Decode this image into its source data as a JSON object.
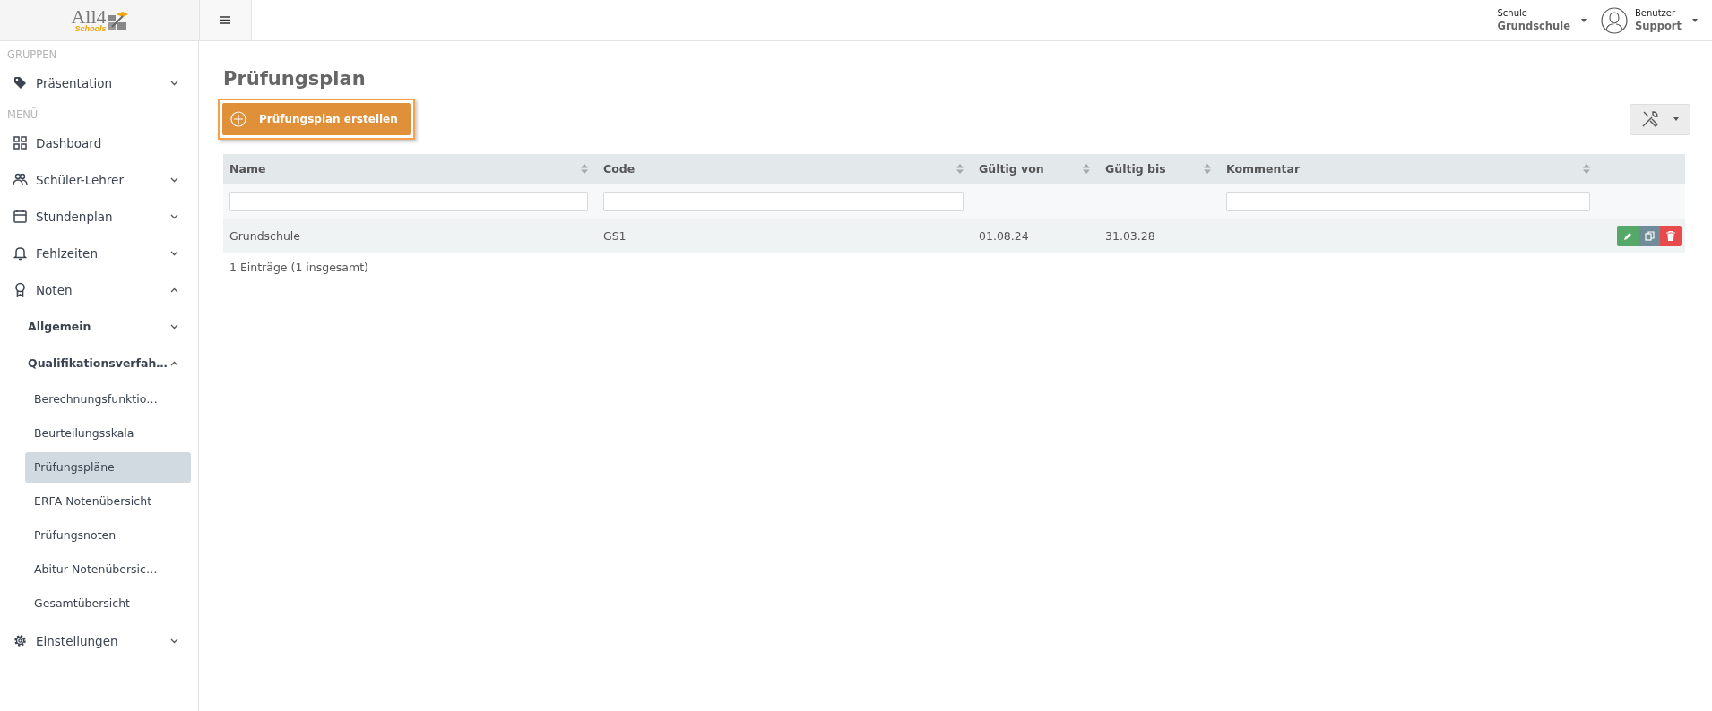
{
  "header": {
    "logo": {
      "name": "All4",
      "tagline": "Schools"
    },
    "school": {
      "label": "Schule",
      "value": "Grundschule"
    },
    "user": {
      "label": "Benutzer",
      "value": "Support"
    }
  },
  "sidebar": {
    "sections": [
      {
        "title": "GRUPPEN",
        "items": [
          {
            "label": "Präsentation",
            "expanded": false
          }
        ]
      },
      {
        "title": "MENÜ",
        "items": [
          {
            "label": "Dashboard"
          },
          {
            "label": "Schüler-Lehrer",
            "expanded": false
          },
          {
            "label": "Stundenplan",
            "expanded": false
          },
          {
            "label": "Fehlzeiten",
            "expanded": false
          },
          {
            "label": "Noten",
            "expanded": true,
            "children": [
              {
                "label": "Allgemein",
                "expanded": false
              },
              {
                "label": "Qualifikationsverfah…",
                "expanded": true,
                "children": [
                  {
                    "label": "Berechnungsfunktio…",
                    "selected": false
                  },
                  {
                    "label": "Beurteilungsskala",
                    "selected": false
                  },
                  {
                    "label": "Prüfungspläne",
                    "selected": true
                  },
                  {
                    "label": "ERFA Notenübersicht",
                    "selected": false
                  },
                  {
                    "label": "Prüfungsnoten",
                    "selected": false
                  },
                  {
                    "label": "Abitur Notenübersic…",
                    "selected": false
                  },
                  {
                    "label": "Gesamtübersicht",
                    "selected": false
                  }
                ]
              }
            ]
          },
          {
            "label": "Einstellungen",
            "expanded": false
          }
        ]
      }
    ]
  },
  "page": {
    "title": "Prüfungsplan",
    "create_button": "Prüfungsplan erstellen",
    "table": {
      "columns": [
        {
          "label": "Name",
          "filter": true
        },
        {
          "label": "Code",
          "filter": true
        },
        {
          "label": "Gültig von",
          "filter": false
        },
        {
          "label": "Gültig bis",
          "filter": false
        },
        {
          "label": "Kommentar",
          "filter": true
        }
      ],
      "rows": [
        {
          "cells": [
            "Grundschule",
            "GS1",
            "01.08.24",
            "31.03.28",
            null
          ]
        }
      ],
      "footer": "1 Einträge (1 insgesamt)"
    }
  }
}
